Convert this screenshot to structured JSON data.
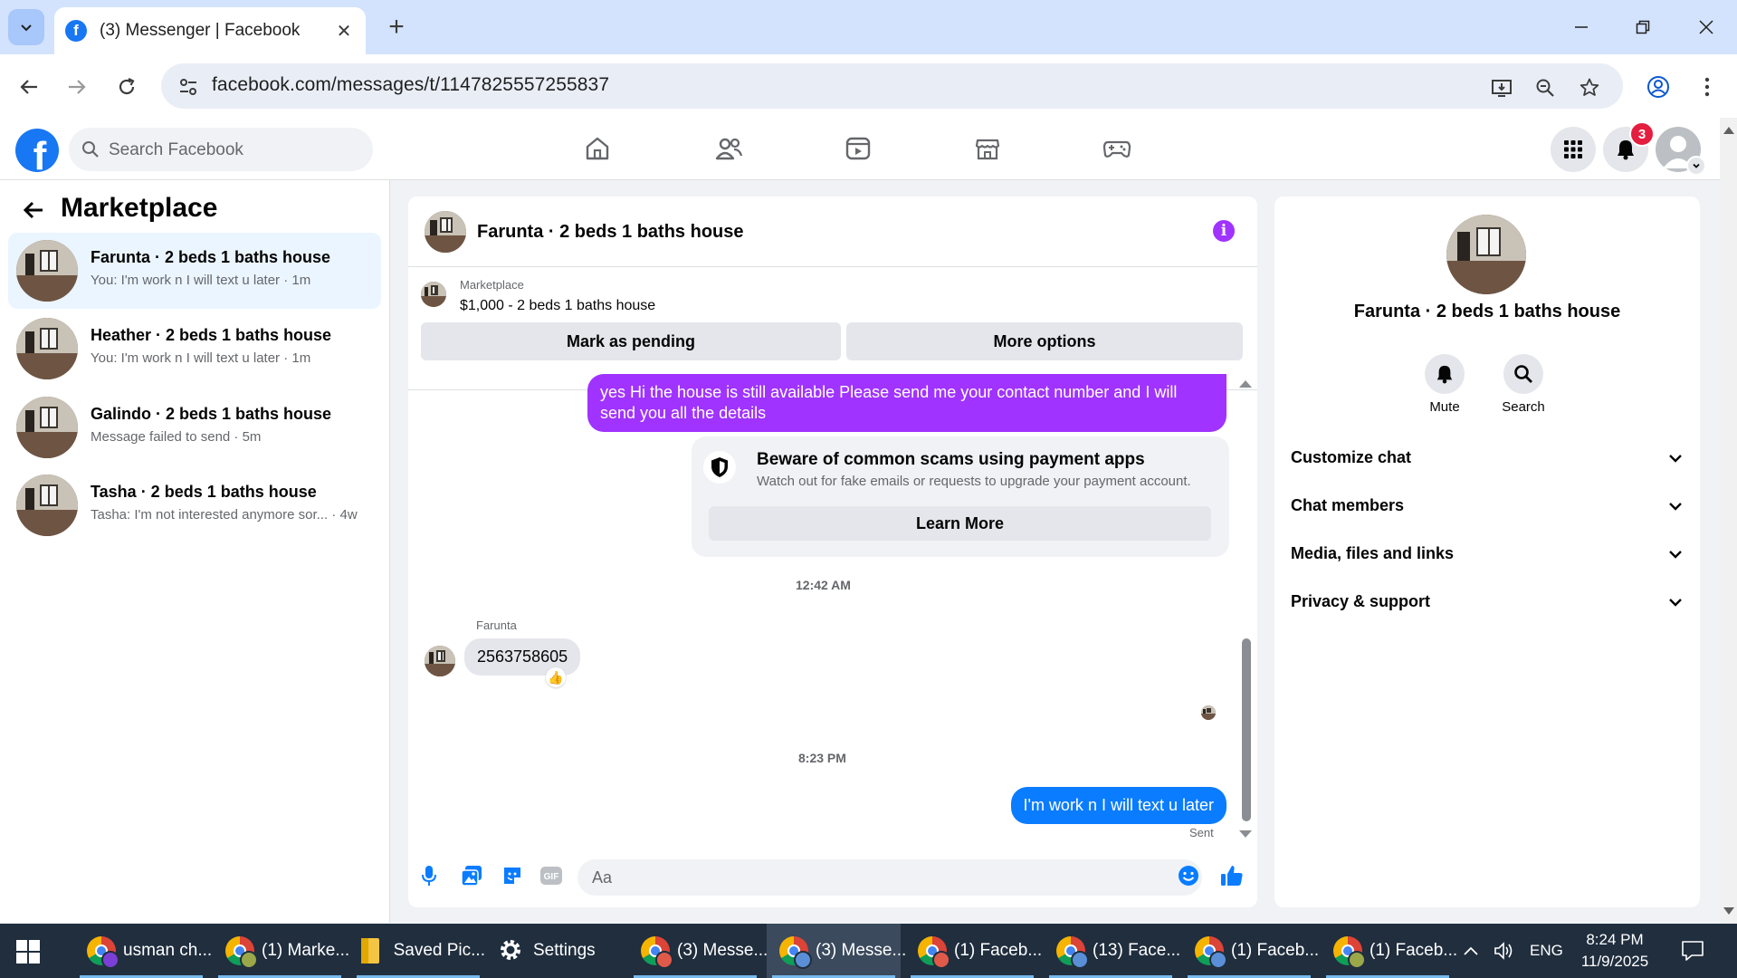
{
  "browser": {
    "tab_title": "(3) Messenger | Facebook",
    "url": "facebook.com/messages/t/1147825557255837"
  },
  "fb_header": {
    "search_placeholder": "Search Facebook",
    "notification_count": "3",
    "brand_color": "#1877f2"
  },
  "sidebar": {
    "title": "Marketplace",
    "conversations": [
      {
        "name": "Farunta · 2 beds 1 baths house",
        "preview": "You: I'm work n I will text u later · 1m",
        "active": true
      },
      {
        "name": "Heather · 2 beds 1 baths house",
        "preview": "You: I'm work n I will text u later · 1m",
        "active": false
      },
      {
        "name": "Galindo · 2 beds 1 baths house",
        "preview": "Message failed to send · 5m",
        "active": false
      },
      {
        "name": "Tasha · 2 beds 1 baths house",
        "preview": "Tasha: I'm not interested anymore sor... · 4w",
        "active": false
      }
    ]
  },
  "chat": {
    "title": "Farunta · 2 beds 1 baths house",
    "marketplace_label": "Marketplace",
    "listing": "$1,000 - 2 beds 1 baths house",
    "mark_pending_label": "Mark as pending",
    "more_options_label": "More options",
    "messages": {
      "outgoing_1": "yes Hi the house is still available Please send me your contact number and I will send you all the details",
      "scam_title": "Beware of common scams using payment apps",
      "scam_body": "Watch out for fake emails or requests to upgrade your payment account.",
      "learn_more": "Learn More",
      "time_1": "12:42 AM",
      "sender_name": "Farunta",
      "incoming_1": "2563758605",
      "reaction": "👍",
      "time_2": "8:23 PM",
      "outgoing_2": "I'm work n I will text u later",
      "status": "Sent"
    },
    "composer_placeholder": "Aa",
    "colors": {
      "outgoing_purple": "#a033ff",
      "outgoing_blue": "#0a7cff"
    }
  },
  "details": {
    "name": "Farunta · 2 beds 1 baths house",
    "actions": [
      {
        "label": "Mute"
      },
      {
        "label": "Search"
      }
    ],
    "sections": [
      "Customize chat",
      "Chat members",
      "Media, files and links",
      "Privacy & support"
    ]
  },
  "taskbar": {
    "items": [
      {
        "label": "usman ch..."
      },
      {
        "label": "(1) Marke..."
      },
      {
        "label": "Saved Pic..."
      },
      {
        "label": "Settings"
      },
      {
        "label": "(3) Messe..."
      },
      {
        "label": "(3) Messe..."
      },
      {
        "label": "(1) Faceb..."
      },
      {
        "label": "(13) Face..."
      },
      {
        "label": "(1) Faceb..."
      },
      {
        "label": "(1) Faceb..."
      }
    ],
    "language": "ENG",
    "time": "8:24 PM",
    "date": "11/9/2025"
  }
}
